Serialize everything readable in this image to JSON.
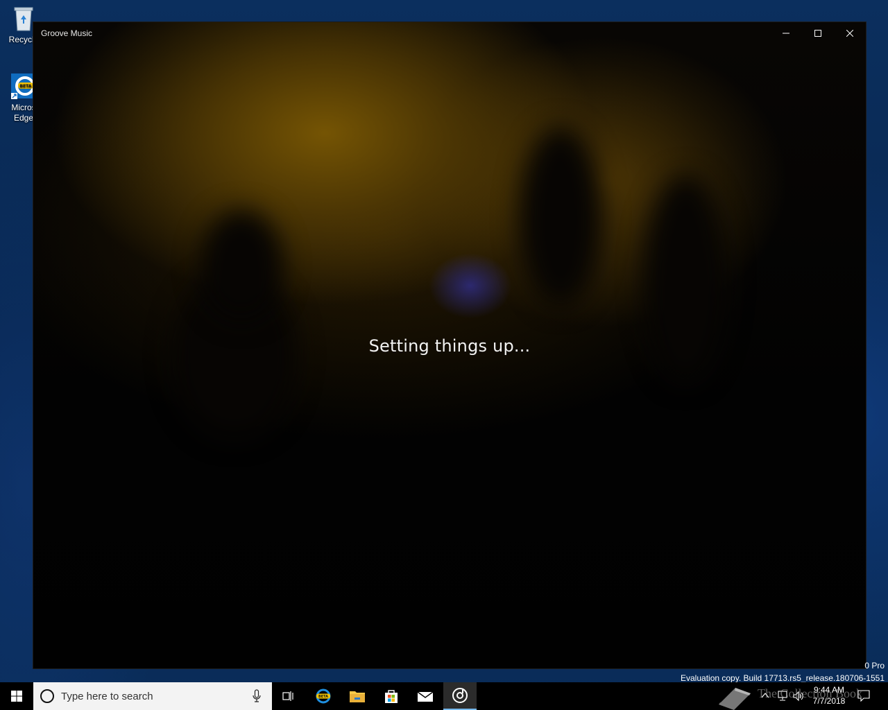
{
  "desktop": {
    "icons": [
      {
        "label": "Recycle",
        "icon": "recycle-bin-icon"
      },
      {
        "label": "Micros\nEdge",
        "icon": "edge-beta-icon"
      }
    ]
  },
  "window": {
    "title": "Groove Music",
    "status_text": "Setting things up...",
    "controls": {
      "minimize": "minimize-icon",
      "maximize": "maximize-icon",
      "close": "close-icon"
    }
  },
  "watermark": {
    "edition": "0 Pro",
    "build": "Evaluation copy. Build 17713.rs5_release.180706-1551"
  },
  "taskbar": {
    "search_placeholder": "Type here to search",
    "pinned": [
      {
        "name": "task-view-icon"
      },
      {
        "name": "edge-beta-icon"
      },
      {
        "name": "file-explorer-icon"
      },
      {
        "name": "store-icon"
      },
      {
        "name": "mail-icon"
      },
      {
        "name": "groove-music-icon",
        "active": true
      }
    ],
    "clock": {
      "time": "9:44 AM",
      "date": "7/7/2018"
    },
    "overlay_text": "The Collection Book"
  },
  "colors": {
    "accent": "#76b9ed",
    "taskbar": "#000000",
    "desktop": "#0a2d5a"
  }
}
